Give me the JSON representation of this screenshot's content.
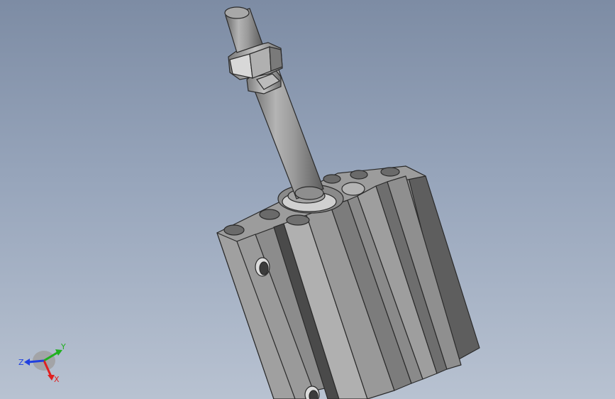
{
  "viewport": {
    "background_top": "#7d8ca4",
    "background_bottom": "#b8c2d1"
  },
  "model": {
    "part": "compact-pneumatic-cylinder",
    "body_color": "#8e8e8e",
    "edge_color": "#2a2a2a"
  },
  "triad": {
    "x_label": "X",
    "y_label": "Y",
    "z_label": "Z",
    "x_color": "#e02020",
    "y_color": "#20b020",
    "z_color": "#2040e0"
  }
}
